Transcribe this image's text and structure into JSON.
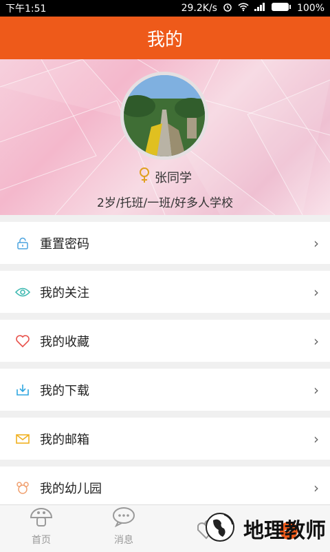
{
  "status_bar": {
    "time": "下午1:51",
    "speed": "29.2K/s",
    "battery": "100%"
  },
  "header": {
    "title": "我的"
  },
  "profile": {
    "name": "张同学",
    "details": "2岁/托班/一班/好多人学校"
  },
  "menu": [
    {
      "label": "重置密码",
      "icon": "lock-icon"
    },
    {
      "label": "我的关注",
      "icon": "eye-icon"
    },
    {
      "label": "我的收藏",
      "icon": "heart-icon"
    },
    {
      "label": "我的下载",
      "icon": "download-icon"
    },
    {
      "label": "我的邮箱",
      "icon": "mail-icon"
    },
    {
      "label": "我的幼儿园",
      "icon": "kindergarten-icon"
    }
  ],
  "tabbar": [
    {
      "label": "首页",
      "icon": "home-mushroom-icon"
    },
    {
      "label": "消息",
      "icon": "message-bubble-icon"
    },
    {
      "label": "",
      "icon": "discover-icon"
    },
    {
      "label": "",
      "icon": "profile-icon"
    }
  ],
  "watermark": {
    "text": "地理教师"
  },
  "colors": {
    "accent": "#ee5a1a",
    "background": "#f0f0f0"
  }
}
